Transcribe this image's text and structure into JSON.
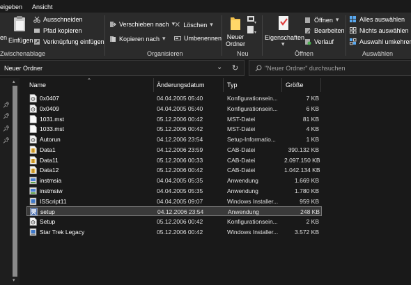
{
  "menu": {
    "tab_share": "eigeben",
    "tab_view": "Ansicht"
  },
  "ribbon": {
    "clipboard": {
      "pin_label": "en",
      "paste_label": "Einfügen",
      "cut": "Ausschneiden",
      "copy_path": "Pfad kopieren",
      "paste_shortcut": "Verknüpfung einfügen",
      "group": "Zwischenablage"
    },
    "organize": {
      "move_to": "Verschieben nach",
      "copy_to": "Kopieren nach",
      "delete": "Löschen",
      "rename": "Umbenennen",
      "group": "Organisieren"
    },
    "new": {
      "new_folder_line1": "Neuer",
      "new_folder_line2": "Ordner",
      "group": "Neu"
    },
    "open": {
      "properties": "Eigenschaften",
      "open": "Öffnen",
      "edit": "Bearbeiten",
      "history": "Verlauf",
      "group": "Öffnen"
    },
    "select": {
      "select_all": "Alles auswählen",
      "select_none": "Nichts auswählen",
      "invert": "Auswahl umkehren",
      "group": "Auswählen"
    }
  },
  "address": {
    "path": "Neuer Ordner",
    "search_placeholder": "\"Neuer Ordner\" durchsuchen"
  },
  "columns": {
    "name": "Name",
    "date": "Änderungsdatum",
    "type": "Typ",
    "size": "Größe"
  },
  "files": [
    {
      "name": "0x0407",
      "date": "04.04.2005 05:40",
      "type": "Konfigurationsein...",
      "size": "7 KB",
      "icon": "config-icon"
    },
    {
      "name": "0x0409",
      "date": "04.04.2005 05:40",
      "type": "Konfigurationsein...",
      "size": "6 KB",
      "icon": "config-icon"
    },
    {
      "name": "1031.mst",
      "date": "05.12.2006 00:42",
      "type": "MST-Datei",
      "size": "81 KB",
      "icon": "blank-file-icon"
    },
    {
      "name": "1033.mst",
      "date": "05.12.2006 00:42",
      "type": "MST-Datei",
      "size": "4 KB",
      "icon": "blank-file-icon"
    },
    {
      "name": "Autorun",
      "date": "04.12.2006 23:54",
      "type": "Setup-Informatio...",
      "size": "1 KB",
      "icon": "config-icon"
    },
    {
      "name": "Data1",
      "date": "04.12.2006 23:59",
      "type": "CAB-Datei",
      "size": "390.132 KB",
      "icon": "cab-icon"
    },
    {
      "name": "Data11",
      "date": "05.12.2006 00:33",
      "type": "CAB-Datei",
      "size": "2.097.150 KB",
      "icon": "cab-icon"
    },
    {
      "name": "Data12",
      "date": "05.12.2006 00:42",
      "type": "CAB-Datei",
      "size": "1.042.134 KB",
      "icon": "cab-icon"
    },
    {
      "name": "instmsia",
      "date": "04.04.2005 05:35",
      "type": "Anwendung",
      "size": "1.669 KB",
      "icon": "installer-app-icon"
    },
    {
      "name": "instmsiw",
      "date": "04.04.2005 05:35",
      "type": "Anwendung",
      "size": "1.780 KB",
      "icon": "installer-app-icon"
    },
    {
      "name": "ISScript11",
      "date": "04.04.2005 09:07",
      "type": "Windows Installer...",
      "size": "959 KB",
      "icon": "msi-icon"
    },
    {
      "name": "setup",
      "date": "04.12.2006 23:54",
      "type": "Anwendung",
      "size": "248 KB",
      "icon": "setup-app-icon",
      "selected": true
    },
    {
      "name": "Setup",
      "date": "05.12.2006 00:42",
      "type": "Konfigurationsein...",
      "size": "2 KB",
      "icon": "config-icon"
    },
    {
      "name": "Star Trek Legacy",
      "date": "05.12.2006 00:42",
      "type": "Windows Installer...",
      "size": "3.572 KB",
      "icon": "msi-icon"
    }
  ]
}
